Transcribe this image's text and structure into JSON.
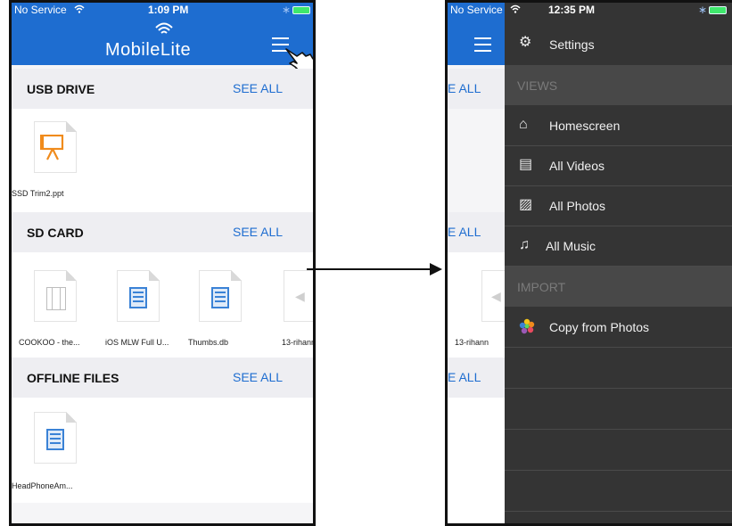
{
  "left_phone": {
    "status": {
      "carrier": "No Service",
      "time": "1:09 PM"
    },
    "app_title": "MobileLite",
    "sections": [
      {
        "title": "USB DRIVE",
        "see_all": "SEE ALL",
        "files": [
          {
            "name": "SSD Trim2.ppt",
            "type": "presentation"
          }
        ]
      },
      {
        "title": "SD CARD",
        "see_all": "SEE ALL",
        "files": [
          {
            "name": "COOKOO - the...",
            "type": "video"
          },
          {
            "name": "iOS MLW Full U...",
            "type": "document"
          },
          {
            "name": "Thumbs.db",
            "type": "document"
          },
          {
            "name": "13-rihann",
            "type": "audio"
          }
        ]
      },
      {
        "title": "OFFLINE FILES",
        "see_all": "SEE ALL",
        "files": [
          {
            "name": "HeadPhoneAm...",
            "type": "document"
          }
        ]
      }
    ]
  },
  "right_phone": {
    "status": {
      "carrier": "No Service",
      "time": "12:35 PM"
    },
    "underlay": {
      "see_all_fragment": "E ALL",
      "file_fragment": "13-rihann"
    },
    "menu": {
      "settings": "Settings",
      "views_header": "VIEWS",
      "views": [
        {
          "label": "Homescreen",
          "icon": "home-icon"
        },
        {
          "label": "All Videos",
          "icon": "film-icon"
        },
        {
          "label": "All Photos",
          "icon": "photo-icon"
        },
        {
          "label": "All Music",
          "icon": "music-icon"
        }
      ],
      "import_header": "IMPORT",
      "import": [
        {
          "label": "Copy from Photos",
          "icon": "photos-flower-icon"
        }
      ]
    }
  },
  "colors": {
    "accent": "#1e6dd0",
    "drawer": "#343434",
    "drawer_section": "#484848",
    "battery": "#3fe86c",
    "ppt_orange": "#f08b1c"
  }
}
